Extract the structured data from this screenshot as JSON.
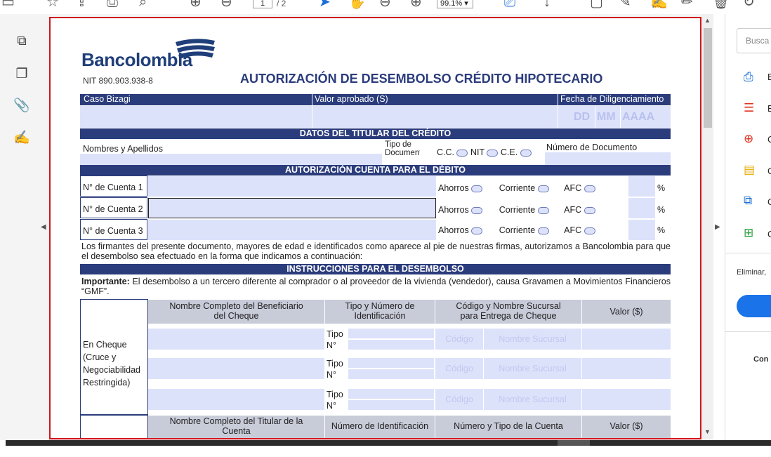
{
  "toolbar": {
    "page_current": "1",
    "page_total": "/ 2",
    "zoom": "99.1%"
  },
  "right_panel": {
    "search_placeholder": "Busca",
    "tools_initials": [
      "E",
      "E",
      "C",
      "C",
      "C",
      "C"
    ],
    "remove_text": "Eliminar,",
    "bottom_text": "Con"
  },
  "form": {
    "logo": "Bancolombia",
    "nit": "NIT 890.903.938-8",
    "title": "AUTORIZACIÓN DE DESEMBOLSO CRÉDITO HIPOTECARIO",
    "caso": "Caso Bizagi",
    "valor_aprobado": "Valor aprobado (S)",
    "fecha": "Fecha de Diligenciamiento",
    "dd": "DD",
    "mm": "MM",
    "aaaa": "AAAA",
    "sec_titular": "DATOS DEL TITULAR DEL CRÉDITO",
    "nombres": "Nombres y Apellidos",
    "tipo_doc": "Tipo de Documento",
    "cc": "C.C.",
    "nit_opt": "NIT",
    "ce": "C.E.",
    "num_doc": "Número de Documento",
    "sec_cuenta": "AUTORIZACIÓN CUENTA PARA EL DÉBITO",
    "cuentas": [
      "N° de Cuenta 1",
      "N° de Cuenta 2",
      "N° de Cuenta 3"
    ],
    "ahorros": "Ahorros",
    "corriente": "Corriente",
    "afc": "AFC",
    "pct": "%",
    "firmantes": "Los firmantes del presente documento, mayores de edad e identificados como aparece al pie de nuestras firmas, autorizamos a Bancolombia para que el desembolso sea efectuado en la forma que indicamos a continuación:",
    "sec_instr": "INSTRUCCIONES PARA EL DESEMBOLSO",
    "importante_label": "Importante:",
    "importante_text": " El desembolso a un tercero diferente al comprador o al proveedor de la vivienda (vendedor), causa Gravamen a Movimientos Financieros “GMF”.",
    "col_beneficiario": "Nombre Completo del Beneficiario del Cheque",
    "col_tipo_num": "Tipo y Número de Identificación",
    "col_codigo_sucursal": "Código y Nombre Sucursal para Entrega de Cheque",
    "col_valor": "Valor ($)",
    "en_cheque": "En Cheque (Cruce y Negociabilidad Restringida)",
    "tipo": "Tipo",
    "n": "N°",
    "codigo": "Código",
    "nombre_sucursal": "Nombre Sucursal",
    "col_titular_cuenta": "Nombre Completo del Titular de la Cuenta",
    "col_num_id": "Número de Identificación",
    "col_num_tipo_cuenta": "Número y Tipo de la Cuenta"
  }
}
